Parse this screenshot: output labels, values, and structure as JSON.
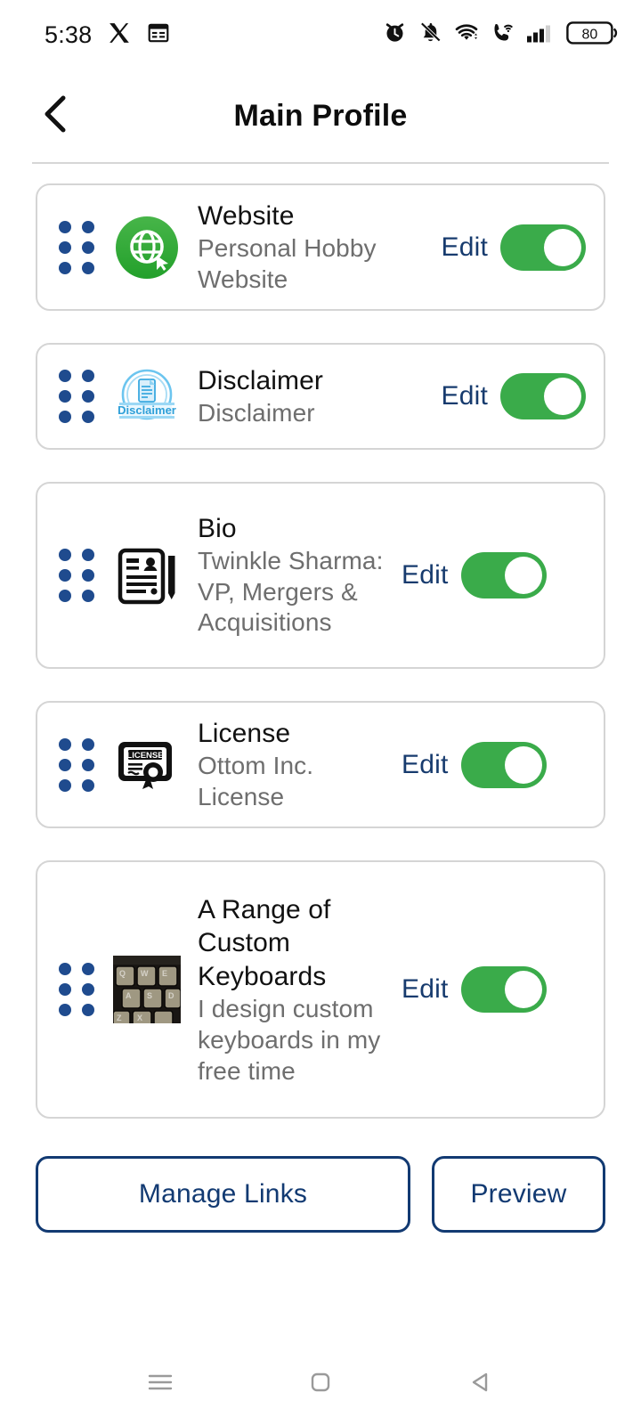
{
  "status_bar": {
    "time": "5:38",
    "left_icons": [
      "x-app-icon",
      "calendar-app-icon"
    ],
    "right_icons": [
      "alarm-icon",
      "bell-off-icon",
      "wifi-icon",
      "wifi-calling-icon",
      "signal-bars-icon"
    ],
    "battery_level": "80"
  },
  "header": {
    "back_icon": "chevron-left-icon",
    "title": "Main Profile"
  },
  "colors": {
    "accent_navy": "#173b6e",
    "toggle_green": "#3aab4a",
    "drag_dot_navy": "#1f4b8e",
    "card_border": "#d5d5d5",
    "subtitle_gray": "#6e6e6e"
  },
  "cards": [
    {
      "id": "website",
      "icon": "globe-cursor-icon",
      "title": "Website",
      "subtitle": "Personal Hobby Website",
      "edit_label": "Edit",
      "enabled": true
    },
    {
      "id": "disclaimer",
      "icon": "disclaimer-badge-icon",
      "title": "Disclaimer",
      "subtitle": "Disclaimer",
      "edit_label": "Edit",
      "enabled": true
    },
    {
      "id": "bio",
      "icon": "resume-pencil-icon",
      "title": "Bio",
      "subtitle": "Twinkle Sharma: VP, Mergers & Acquisitions",
      "edit_label": "Edit",
      "enabled": true
    },
    {
      "id": "license",
      "icon": "license-certificate-icon",
      "title": "License",
      "subtitle": "Ottom Inc. License",
      "edit_label": "Edit",
      "enabled": true
    },
    {
      "id": "custom-keyboards",
      "icon": "keyboard-photo-thumbnail",
      "title": "A Range of Custom Keyboards",
      "subtitle": "I design custom keyboards in my free time",
      "edit_label": "Edit",
      "enabled": true
    }
  ],
  "actions": {
    "manage_links_label": "Manage Links",
    "preview_label": "Preview"
  },
  "nav_bar": {
    "recents_icon": "menu-lines-icon",
    "home_icon": "home-square-icon",
    "back_icon": "back-triangle-icon"
  }
}
